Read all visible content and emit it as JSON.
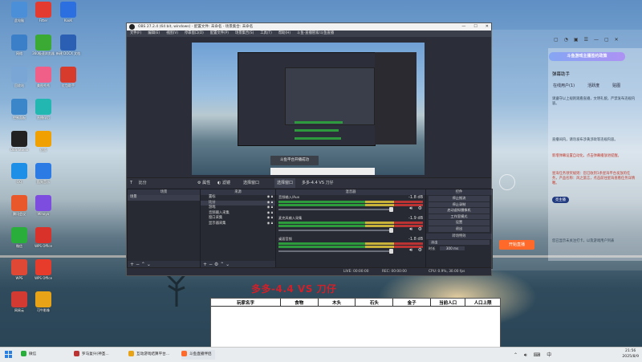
{
  "desktop": {
    "icons": [
      {
        "label": "此电脑",
        "icon": "computer-icon",
        "color": "#4a8fd8"
      },
      {
        "label": "Fitter",
        "icon": "fitter-icon",
        "color": "#e33b2f"
      },
      {
        "label": "KooK",
        "icon": "kook-icon",
        "color": "#2b6fe0"
      },
      {
        "label": "网络",
        "icon": "network-icon",
        "color": "#3b7fc9"
      },
      {
        "label": "360极速浏览器",
        "icon": "browser-icon",
        "color": "#3aaa35"
      },
      {
        "label": "新建 DOCX 文档",
        "icon": "word-doc-icon",
        "color": "#2b5fb3"
      },
      {
        "label": "回收站",
        "icon": "recycle-bin-icon",
        "color": "#7aa6d6"
      },
      {
        "label": "美图秀秀",
        "icon": "photo-app-icon",
        "color": "#ef5f88"
      },
      {
        "label": "红包助手",
        "icon": "redpacket-icon",
        "color": "#d63b2c"
      },
      {
        "label": "控制面板",
        "icon": "control-panel-icon",
        "color": "#3b86c9"
      },
      {
        "label": "直播伴侣",
        "icon": "live-companion-icon",
        "color": "#23b7b1"
      },
      {
        "label": "OBS Studio",
        "icon": "obs-icon",
        "color": "#222"
      },
      {
        "label": "优酷",
        "icon": "media-icon",
        "color": "#f0a000"
      },
      {
        "label": "QQ",
        "icon": "qq-icon",
        "color": "#1e8fe6"
      },
      {
        "label": "酷狗音乐",
        "icon": "music-icon",
        "color": "#2c7be5"
      },
      {
        "label": "腾讯会议",
        "icon": "meeting-icon",
        "color": "#e9582b"
      },
      {
        "label": "Mihoyo",
        "icon": "game-icon",
        "color": "#7c4ddf"
      },
      {
        "label": "微信",
        "icon": "wechat-icon",
        "color": "#2aae3b"
      },
      {
        "label": "WPS Office",
        "icon": "wps-icon",
        "color": "#d8322a"
      },
      {
        "label": "WPS",
        "icon": "wps-pdf-icon",
        "color": "#e04836"
      },
      {
        "label": "WPS Office",
        "icon": "wps-office-icon",
        "color": "#e73b2b"
      },
      {
        "label": "网易云",
        "icon": "cloud-music-icon",
        "color": "#d33a31"
      },
      {
        "label": "可牛影像",
        "icon": "game2-icon",
        "color": "#e8a317"
      }
    ]
  },
  "obs": {
    "title": "OBS 27.2.4 (64 bit, windows) - 配置文件: 未命名 - 场景集合: 未命名",
    "menu": [
      "文件(F)",
      "编辑(E)",
      "视图(V)",
      "停靠窗口(D)",
      "配置文件(P)",
      "场景集合(S)",
      "工具(T)",
      "帮助(H)",
      "斗鱼-直播管家/斗鱼直播"
    ],
    "preview_banner": "斗鱼平台开播成功",
    "source_title": "比分",
    "toolbar": {
      "props": "属性",
      "filters": "滤镜",
      "select_window": "选择窗口",
      "window_capture": "选择窗口",
      "match": "多多-4.4 VS 刀仔"
    },
    "scenes": {
      "title": "场景",
      "items": [
        "场景"
      ]
    },
    "sources": {
      "title": "来源",
      "items": [
        "置标",
        "比分",
        "游戏",
        "音频输入采集",
        "窗口采集",
        "显示器采集"
      ]
    },
    "mixer": {
      "title": "混音器",
      "channels": [
        {
          "name": "音频输入/Aux",
          "db": "-1.8 dB"
        },
        {
          "name": "麦克风输入采集",
          "db": "-1.9 dB"
        },
        {
          "name": "桌面音频",
          "db": "-1.8 dB"
        }
      ]
    },
    "controls": {
      "title": "控件",
      "buttons": [
        "停止推流",
        "停止录制",
        "启动虚拟摄像机",
        "工作室模式",
        "设置",
        "退出"
      ]
    },
    "transitions": {
      "title": "转场特效",
      "type": "淡出",
      "duration_label": "时长",
      "duration": "300 ms"
    },
    "status": {
      "live": "LIVE: 00:00:00",
      "rec": "REC: 00:00:00",
      "cpu": "CPU: 0.9%, 30.00 fps"
    }
  },
  "helper_app": {
    "promo": "斗鱼游戏主播签约政策",
    "title": "弹幕助手",
    "tabs": [
      "在线用户(1)",
      "活跃度",
      "贴图"
    ],
    "lines": [
      "请遵守以上规则观看直播，文明礼貌，严禁发布违规内容。",
      "直播间内，请勿发布涉黄涉政等违规内容。",
      "新增弹幕设置自动化，点击弹幕播放进提醒。",
      "星海任务领奖规则：您已收到1条星海平台发放的任务，产品名称：风之旅言，点击前往星海查看任务详情喔。"
    ],
    "follow_hint": "您已显示未关注打卡，以及游戏用户列表",
    "start_live": "开始直播",
    "badge": "亮主播"
  },
  "game_overlay": {
    "title": "多多-4.4 VS 刀仔",
    "columns": [
      "玩家名字",
      "食物",
      "木头",
      "石头",
      "金子",
      "当前人口",
      "人口上限"
    ]
  },
  "taskbar": {
    "items": [
      "微信",
      "罗马复兴(神圣...",
      "互动游戏结算平台...",
      "斗鱼直播伴侣"
    ],
    "time": "21:56",
    "date": "2025/8/9"
  }
}
